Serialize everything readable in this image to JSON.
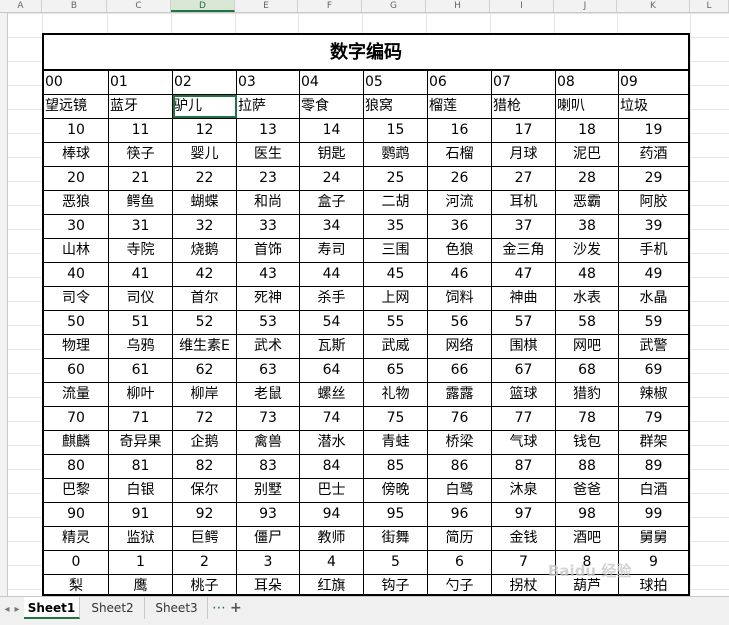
{
  "columns": [
    "A",
    "B",
    "C",
    "D",
    "E",
    "F",
    "G",
    "H",
    "I",
    "J",
    "K",
    "L"
  ],
  "selected_column": "D",
  "table": {
    "title": "数字编码",
    "rows": [
      [
        "00",
        "01",
        "02",
        "03",
        "04",
        "05",
        "06",
        "07",
        "08",
        "09"
      ],
      [
        "望远镜",
        "蓝牙",
        "驴儿",
        "拉萨",
        "零食",
        "狼窝",
        "榴莲",
        "猎枪",
        "喇叭",
        "垃圾"
      ],
      [
        "10",
        "11",
        "12",
        "13",
        "14",
        "15",
        "16",
        "17",
        "18",
        "19"
      ],
      [
        "棒球",
        "筷子",
        "婴儿",
        "医生",
        "钥匙",
        "鹦鹉",
        "石榴",
        "月球",
        "泥巴",
        "药酒"
      ],
      [
        "20",
        "21",
        "22",
        "23",
        "24",
        "25",
        "26",
        "27",
        "28",
        "29"
      ],
      [
        "恶狼",
        "鳄鱼",
        "蝴蝶",
        "和尚",
        "盒子",
        "二胡",
        "河流",
        "耳机",
        "恶霸",
        "阿胶"
      ],
      [
        "30",
        "31",
        "32",
        "33",
        "34",
        "35",
        "36",
        "37",
        "38",
        "39"
      ],
      [
        "山林",
        "寺院",
        "烧鹅",
        "首饰",
        "寿司",
        "三围",
        "色狼",
        "金三角",
        "沙发",
        "手机"
      ],
      [
        "40",
        "41",
        "42",
        "43",
        "44",
        "45",
        "46",
        "47",
        "48",
        "49"
      ],
      [
        "司令",
        "司仪",
        "首尔",
        "死神",
        "杀手",
        "上网",
        "饲料",
        "神曲",
        "水表",
        "水晶"
      ],
      [
        "50",
        "51",
        "52",
        "53",
        "54",
        "55",
        "56",
        "57",
        "58",
        "59"
      ],
      [
        "物理",
        "乌鸦",
        "维生素E",
        "武术",
        "瓦斯",
        "武威",
        "网络",
        "围棋",
        "网吧",
        "武警"
      ],
      [
        "60",
        "61",
        "62",
        "63",
        "64",
        "65",
        "66",
        "67",
        "68",
        "69"
      ],
      [
        "流量",
        "柳叶",
        "柳岸",
        "老鼠",
        "螺丝",
        "礼物",
        "露露",
        "篮球",
        "猎豹",
        "辣椒"
      ],
      [
        "70",
        "71",
        "72",
        "73",
        "74",
        "75",
        "76",
        "77",
        "78",
        "79"
      ],
      [
        "麒麟",
        "奇异果",
        "企鹅",
        "禽兽",
        "潜水",
        "青蛙",
        "桥梁",
        "气球",
        "钱包",
        "群架"
      ],
      [
        "80",
        "81",
        "82",
        "83",
        "84",
        "85",
        "86",
        "87",
        "88",
        "89"
      ],
      [
        "巴黎",
        "白银",
        "保尔",
        "别墅",
        "巴士",
        "傍晚",
        "白鹭",
        "沐泉",
        "爸爸",
        "白酒"
      ],
      [
        "90",
        "91",
        "92",
        "93",
        "94",
        "95",
        "96",
        "97",
        "98",
        "99"
      ],
      [
        "精灵",
        "监狱",
        "巨鳄",
        "僵尸",
        "教师",
        "街舞",
        "简历",
        "金钱",
        "酒吧",
        "舅舅"
      ],
      [
        "0",
        "1",
        "2",
        "3",
        "4",
        "5",
        "6",
        "7",
        "8",
        "9"
      ],
      [
        "梨",
        "鹰",
        "桃子",
        "耳朵",
        "红旗",
        "钩子",
        "勺子",
        "拐杖",
        "葫芦",
        "球拍"
      ]
    ]
  },
  "sheet_tabs": [
    "Sheet1",
    "Sheet2",
    "Sheet3"
  ],
  "active_tab": "Sheet1",
  "tab_more_icon": "⋯",
  "tab_add_icon": "+",
  "nav_prev_icon": "◂",
  "nav_next_icon": "▸",
  "accent_color": "#217346"
}
